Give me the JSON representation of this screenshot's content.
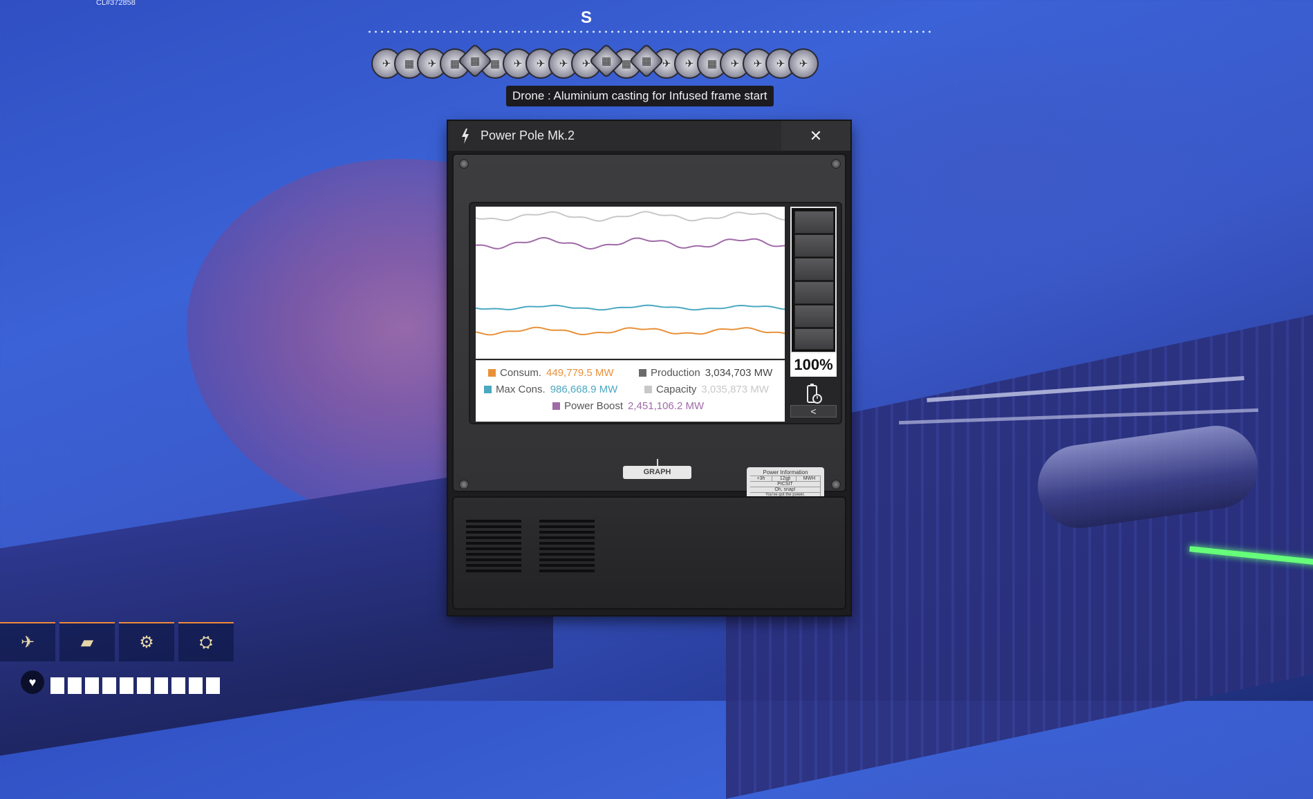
{
  "hud": {
    "build_id": "CL#372858",
    "compass_letter": "S",
    "tooltip": "Drone : Aluminium casting for Infused frame start",
    "waypoints": [
      "drone-icon",
      "factory-icon",
      "drone-icon",
      "factory-icon",
      "factory-icon",
      "factory-icon",
      "drone-icon",
      "drone-icon",
      "drone-icon",
      "drone-icon",
      "factory-icon",
      "factory-icon",
      "factory-icon",
      "drone-icon",
      "drone-icon",
      "factory-icon",
      "drone-icon",
      "drone-icon",
      "drone-icon",
      "drone-icon"
    ]
  },
  "window": {
    "title": "Power Pole Mk.2",
    "close_label": "✕",
    "graph_tab": "GRAPH",
    "battery_percent": "100%",
    "collapse_label": "<",
    "info_card": {
      "title": "Power Information",
      "row1": [
        "+3h",
        "12gjt",
        "MWH"
      ],
      "row2": [
        "PICSIT"
      ],
      "row3": [
        "Oh, snap!"
      ],
      "footer": "You've got the power."
    }
  },
  "legend": {
    "consumption": {
      "label": "Consum.",
      "value": "449,779.5 MW",
      "color": "#e8913a"
    },
    "production": {
      "label": "Production",
      "value": "3,034,703 MW",
      "color": "#6b6b6b"
    },
    "max_consumption": {
      "label": "Max Cons.",
      "value": "986,668.9 MW",
      "color": "#4aa8c0"
    },
    "capacity": {
      "label": "Capacity",
      "value": "3,035,873 MW",
      "color": "#c8c8c8"
    },
    "power_boost": {
      "label": "Power Boost",
      "value": "2,451,106.2 MW",
      "color": "#a06aa8"
    }
  }
}
